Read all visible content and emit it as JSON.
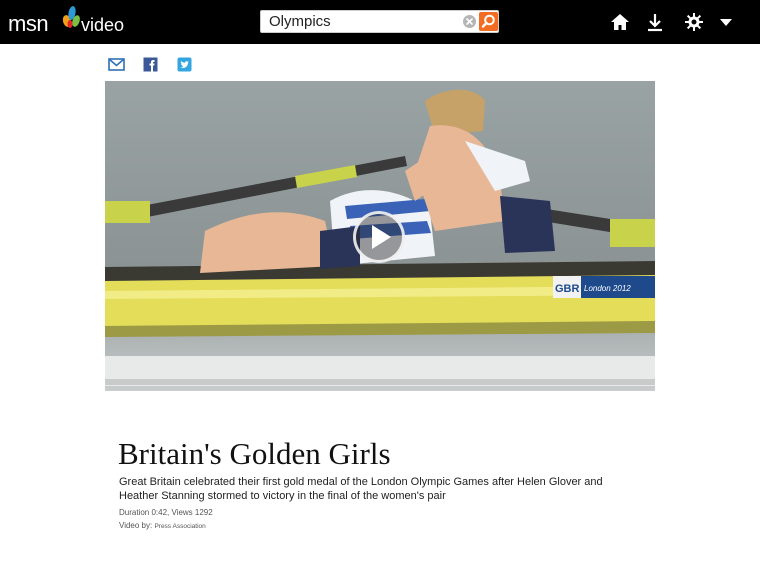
{
  "header": {
    "logo_text": "msn",
    "logo_sub": "video",
    "search": {
      "value": "Olympics",
      "placeholder": ""
    },
    "icons": [
      "home-icon",
      "download-icon",
      "settings-icon",
      "menu-dropdown-icon"
    ]
  },
  "share": {
    "icons": [
      "email-icon",
      "facebook-icon",
      "twitter-icon"
    ]
  },
  "video": {
    "boat_label": "GBR London 2012",
    "play_icon": "play-icon"
  },
  "article": {
    "title": "Britain's Golden Girls",
    "description": "Great Britain celebrated their first gold medal of the London Olympic Games after Helen Glover and Heather Stanning stormed to victory in the final of the women's pair",
    "duration_line": "Duration 0:42, Views 1292",
    "video_by_label": "Video by: ",
    "video_by_source": "Press Association"
  },
  "colors": {
    "topbar": "#000000",
    "search_button": "#f26d22",
    "boat_yellow": "#e3dd5a",
    "share_blue": "#2f6fb5",
    "facebook_blue": "#3b5998",
    "twitter_blue": "#33a6e0"
  }
}
